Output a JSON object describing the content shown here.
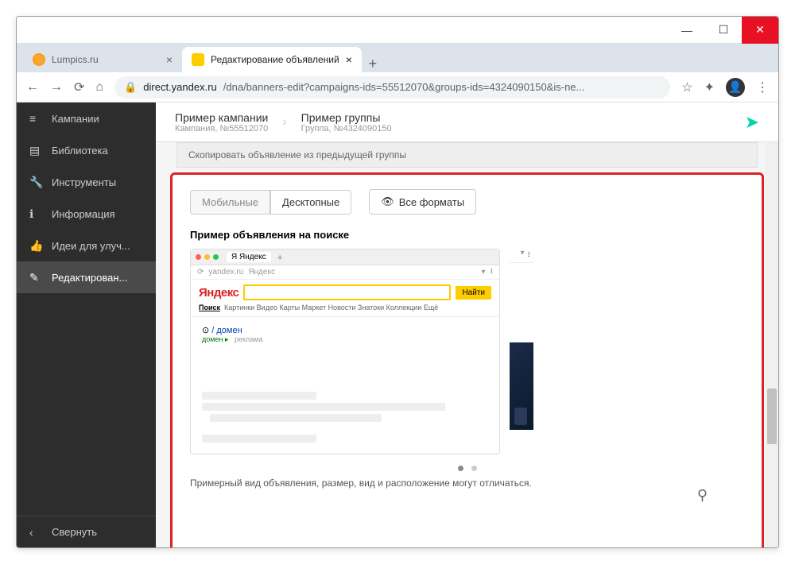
{
  "window": {
    "min": "—",
    "max": "☐",
    "close": "✕"
  },
  "tabs": [
    {
      "title": "Lumpics.ru",
      "active": false
    },
    {
      "title": "Редактирование объявлений",
      "active": true
    }
  ],
  "addressbar": {
    "lock": "🔒",
    "host": "direct.yandex.ru",
    "path": "/dna/banners-edit?campaigns-ids=55512070&groups-ids=4324090150&is-ne...",
    "star": "☆"
  },
  "sidebar": {
    "items": [
      {
        "icon": "≡",
        "label": "Кампании"
      },
      {
        "icon": "▤",
        "label": "Библиотека"
      },
      {
        "icon": "🔧",
        "label": "Инструменты"
      },
      {
        "icon": "ℹ",
        "label": "Информация"
      },
      {
        "icon": "👍",
        "label": "Идеи для улуч..."
      },
      {
        "icon": "✎",
        "label": "Редактирован..."
      }
    ],
    "collapse": {
      "icon": "‹",
      "label": "Свернуть"
    }
  },
  "breadcrumb": {
    "c1_title": "Пример кампании",
    "c1_sub": "Кампания, №55512070",
    "c2_title": "Пример группы",
    "c2_sub": "Группа, №4324090150"
  },
  "copy_prev": "Скопировать объявление из предыдущей группы",
  "format_tabs": {
    "mobile": "Мобильные",
    "desktop": "Десктопные",
    "all": "Все форматы",
    "eye": "👁"
  },
  "section_title": "Пример объявления на поиске",
  "mock": {
    "tab_label": "Я Яндекс",
    "addr_host": "yandex.ru",
    "addr_label": "Яндекс",
    "logo": "Яндекс",
    "find": "Найти",
    "nav": "Картинки  Видео  Карты  Маркет  Новости  Знатоки  Коллекции  Ещё",
    "nav_active": "Поиск",
    "ad_title": "/ домен",
    "ad_bullet": "⊙",
    "ad_green1": "домен",
    "ad_green2": "реклама"
  },
  "hint": "Примерный вид объявления, размер, вид и расположение могут отличаться.",
  "icons": {
    "back": "←",
    "fwd": "→",
    "reload": "⟳",
    "home": "⌂",
    "ext": "✦",
    "menu": "⋮",
    "send": "➤",
    "plus": "+",
    "zoom": "⚲",
    "bookmark": "▾",
    "dl": "⭳"
  }
}
